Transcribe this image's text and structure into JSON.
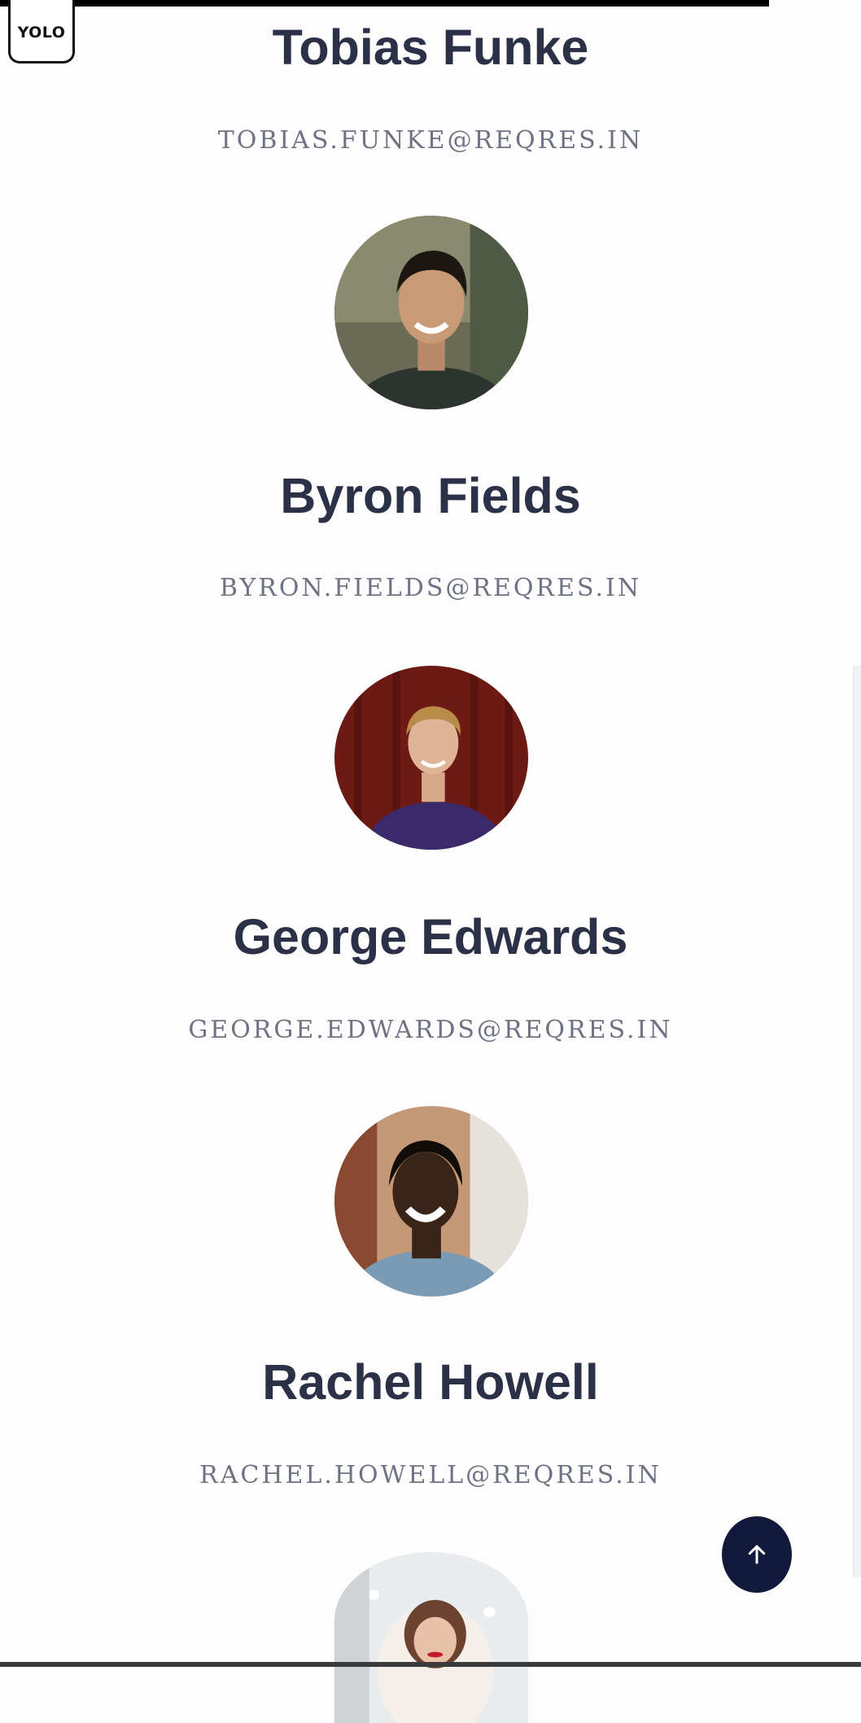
{
  "logo": {
    "text": "YOLO"
  },
  "users": [
    {
      "name": "Tobias Funke",
      "email": "TOBIAS.FUNKE@REQRES.IN"
    },
    {
      "name": "Byron Fields",
      "email": "BYRON.FIELDS@REQRES.IN"
    },
    {
      "name": "George Edwards",
      "email": "GEORGE.EDWARDS@REQRES.IN"
    },
    {
      "name": "Rachel Howell",
      "email": "RACHEL.HOWELL@REQRES.IN"
    }
  ],
  "scroll_top_button": {
    "icon": "arrow-up-icon"
  },
  "colors": {
    "name_text": "#2b3147",
    "email_text": "#6e7283",
    "button_bg": "#121a3c",
    "background": "#fefdfd"
  }
}
